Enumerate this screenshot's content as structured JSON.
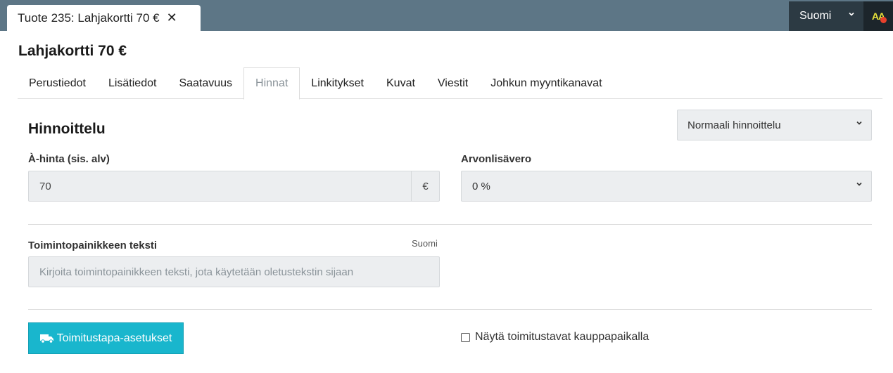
{
  "document_tab": {
    "title": "Tuote 235: Lahjakortti 70 €",
    "close_glyph": "✕"
  },
  "header": {
    "language": "Suomi",
    "avatar_initials": "AA"
  },
  "page_title": "Lahjakortti 70 €",
  "tabs": [
    {
      "label": "Perustiedot"
    },
    {
      "label": "Lisätiedot"
    },
    {
      "label": "Saatavuus"
    },
    {
      "label": "Hinnat",
      "active": true
    },
    {
      "label": "Linkitykset"
    },
    {
      "label": "Kuvat"
    },
    {
      "label": "Viestit"
    },
    {
      "label": "Johkun myyntikanavat"
    }
  ],
  "pricing": {
    "section_title": "Hinnoittelu",
    "pricing_mode": "Normaali hinnoittelu",
    "unit_price_label": "À-hinta (sis. alv)",
    "unit_price_value": "70",
    "currency": "€",
    "vat_label": "Arvonlisävero",
    "vat_value": "0 %"
  },
  "cta_text": {
    "label": "Toimintopainikkeen teksti",
    "language_hint": "Suomi",
    "placeholder": "Kirjoita toimintopainikkeen teksti, jota käytetään oletustekstin sijaan"
  },
  "delivery": {
    "button_label": "Toimitustapa-asetukset",
    "checkbox_label": "Näytä toimitustavat kauppapaikalla"
  },
  "icons": {
    "truck": "truck-icon",
    "close": "close-icon",
    "chevron": "chevron-down-icon"
  },
  "colors": {
    "topbar": "#5d7686",
    "primary_button": "#19b6cd",
    "avatar_text": "#e7e13a",
    "notification_dot": "#e8412c"
  }
}
